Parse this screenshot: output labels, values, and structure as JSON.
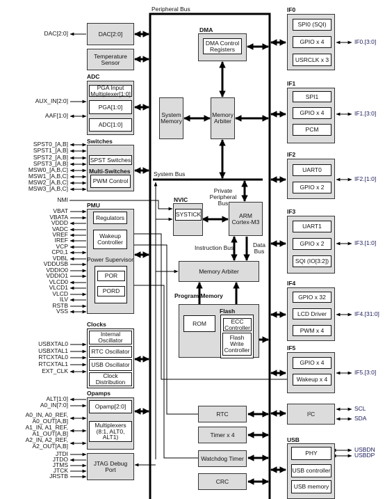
{
  "buses": {
    "peripheral": "Peripheral Bus",
    "system": "System Bus",
    "private": "Private Peripheral Bus",
    "instruction": "Instruction Bus",
    "data": "Data Bus"
  },
  "blocks": {
    "dac": "DAC[2:0]",
    "temp": "Temperature Sensor",
    "adc_label": "ADC",
    "pga_mux": "PGA Input Multiplexer[1:0]",
    "pga": "PGA[1:0]",
    "adc": "ADC[1:0]",
    "switches_label": "Switches",
    "spst": "SPST Switches",
    "multi": "Multi-Switches",
    "pwm_ctrl": "PWM Control",
    "pmu_label": "PMU",
    "regulators": "Regulators",
    "wakeup_ctrl": "Wakeup Controller",
    "power_sup": "Power Supervisor",
    "por": "POR",
    "pord": "PORD",
    "clocks_label": "Clocks",
    "int_osc": "Internal Oscillator",
    "rtc_osc": "RTC Oscillator",
    "usb_osc": "USB Oscillator",
    "clk_dist": "Clock Distribution",
    "opamps_label": "Opamps",
    "opamp": "Opamp[2:0]",
    "mux": "Multiplexers (8:1, ALT0, ALT1)",
    "jtag": "JTAG Debug Port",
    "dma_label": "DMA",
    "dma_regs": "DMA Control Registers",
    "sys_mem": "System Memory",
    "mem_arb1": "Memory Arbiter",
    "nvic_label": "NVIC",
    "systick": "SYSTICK",
    "arm": "ARM Cortex-M3",
    "mem_arb2": "Memory Arbiter",
    "prog_label": "Program Memory",
    "flash_label": "Flash",
    "rom": "ROM",
    "ecc": "ECC Controller",
    "flash_write": "Flash Write Controller",
    "rtc": "RTC",
    "timer": "Timer x 4",
    "watchdog": "Watchdog Timer",
    "crc": "CRC",
    "if0_label": "IF0",
    "spi0": "SPI0 (SQI)",
    "if0_gpio": "GPIO x 4",
    "usrclk": "USRCLK x 3",
    "if1_label": "IF1",
    "spi1": "SPI1",
    "if1_gpio": "GPIO x 4",
    "pcm": "PCM",
    "if2_label": "IF2",
    "uart0": "UART0",
    "if2_gpio": "GPIO x 2",
    "if3_label": "IF3",
    "uart1": "UART1",
    "if3_gpio": "GPIO x 2",
    "sqi": "SQI (IO[3:2])",
    "if4_label": "IF4",
    "if4_gpio": "GPIO x 32",
    "lcd": "LCD Driver",
    "pwm4": "PWM x 4",
    "if5_label": "IF5",
    "if5_gpio": "GPIO x 4",
    "wakeup4": "Wakeup x 4",
    "i2c": "I²C",
    "usb_label": "USB",
    "phy": "PHY",
    "usb_ctrl": "USB controller",
    "usb_mem": "USB memory"
  },
  "left_pins": [
    {
      "label": "DAC[2:0]",
      "dir": "out"
    },
    {
      "label": "AUX_IN[2:0]",
      "dir": "in"
    },
    {
      "label": "AAF[1:0]",
      "dir": "bi"
    },
    {
      "label": "SPST0_[A,B]",
      "dir": "bi"
    },
    {
      "label": "SPST1_[A,B]",
      "dir": "bi"
    },
    {
      "label": "SPST2_[A,B]",
      "dir": "bi"
    },
    {
      "label": "SPST3_[A,B]",
      "dir": "bi"
    },
    {
      "label": "MSW0_[A,B,C]",
      "dir": "bi"
    },
    {
      "label": "MSW1_[A,B,C]",
      "dir": "bi"
    },
    {
      "label": "MSW2_[A,B,C]",
      "dir": "bi"
    },
    {
      "label": "MSW3_[A,B,C]",
      "dir": "bi"
    },
    {
      "label": "NMI",
      "dir": "none"
    },
    {
      "label": "VBAT",
      "dir": "in"
    },
    {
      "label": "VBATA",
      "dir": "in"
    },
    {
      "label": "VDDD",
      "dir": "out"
    },
    {
      "label": "VADC",
      "dir": "out"
    },
    {
      "label": "VREF",
      "dir": "out"
    },
    {
      "label": "IREF",
      "dir": "out"
    },
    {
      "label": "VCP",
      "dir": "out"
    },
    {
      "label": "CP0,1",
      "dir": "bi"
    },
    {
      "label": "VDBL",
      "dir": "out"
    },
    {
      "label": "VDDUSB",
      "dir": "in"
    },
    {
      "label": "VDDIO0",
      "dir": "in"
    },
    {
      "label": "VDDIO1",
      "dir": "in"
    },
    {
      "label": "VLCD0",
      "dir": "out"
    },
    {
      "label": "VLCD1",
      "dir": "out"
    },
    {
      "label": "VLCD",
      "dir": "in"
    },
    {
      "label": "ILV",
      "dir": "out"
    },
    {
      "label": "RSTB",
      "dir": "in"
    },
    {
      "label": "VSS",
      "dir": "bi"
    },
    {
      "label": "USBXTAL0",
      "dir": "in"
    },
    {
      "label": "USBXTAL1",
      "dir": "in"
    },
    {
      "label": "RTCXTAL0",
      "dir": "in"
    },
    {
      "label": "RTCXTAL1",
      "dir": "in"
    },
    {
      "label": "EXT_CLK",
      "dir": "bi"
    },
    {
      "label": "ALT[1:0]",
      "dir": "out"
    },
    {
      "label": "A0_IN[7:0]",
      "dir": "in"
    },
    {
      "label": "A0_IN, A0_REF,\nA0_OUT[A,B]",
      "dir": "bi"
    },
    {
      "label": "A1_IN, A1_REF,\nA1_OUT[A,B]",
      "dir": "bi"
    },
    {
      "label": "A2_IN, A2_REF,\nA2_OUT[A,B]",
      "dir": "bi"
    },
    {
      "label": "JTDI",
      "dir": "in"
    },
    {
      "label": "JTDO",
      "dir": "out"
    },
    {
      "label": "JTMS",
      "dir": "in"
    },
    {
      "label": "JTCK",
      "dir": "in"
    },
    {
      "label": "JRSTB",
      "dir": "in"
    }
  ],
  "right_pins": [
    {
      "label": "IF0.[3:0]"
    },
    {
      "label": "IF1.[3:0]"
    },
    {
      "label": "IF2.[1:0]"
    },
    {
      "label": "IF3.[1:0]"
    },
    {
      "label": "IF4.[31:0]"
    },
    {
      "label": "IF5.[3:0]"
    },
    {
      "label": "SCL"
    },
    {
      "label": "SDA"
    },
    {
      "label": "USBDN"
    },
    {
      "label": "USBDP"
    }
  ]
}
